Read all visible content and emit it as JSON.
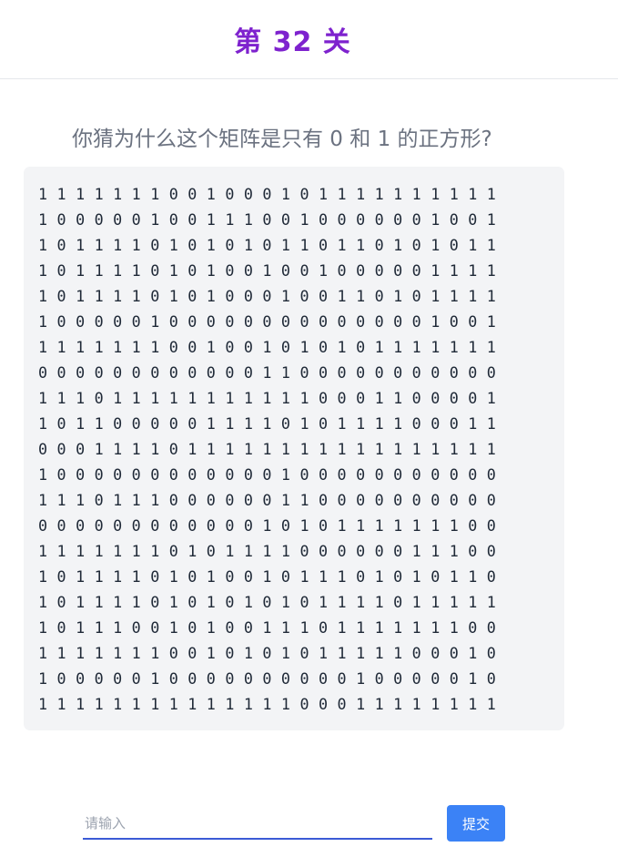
{
  "header": {
    "title": "第 32 关"
  },
  "question": {
    "text": "你猜为什么这个矩阵是只有 0 和 1 的正方形?"
  },
  "matrix": {
    "rows": [
      "1 1 1 1 1 1 1 0 0 1 0 0 0 1 0 1 1 1 1 1 1 1 1 1 1",
      "1 0 0 0 0 0 1 0 0 1 1 1 0 0 1 0 0 0 0 0 0 1 0 0 1",
      "1 0 1 1 1 1 0 1 0 1 0 1 0 1 1 0 1 1 0 1 0 1 0 1 1",
      "1 0 1 1 1 1 0 1 0 1 0 0 1 0 0 1 0 0 0 0 0 1 1 1 1",
      "1 0 1 1 1 1 0 1 0 1 0 0 0 1 0 0 1 1 0 1 0 1 1 1 1",
      "1 0 0 0 0 0 1 0 0 0 0 0 0 0 0 0 0 0 0 0 0 1 0 0 1",
      "1 1 1 1 1 1 1 0 0 1 0 0 1 0 1 0 1 0 1 1 1 1 1 1 1",
      "0 0 0 0 0 0 0 0 0 0 0 0 1 1 0 0 0 0 0 0 0 0 0 0 0",
      "1 1 1 0 1 1 1 1 1 1 1 1 1 1 1 0 0 0 1 1 0 0 0 0 1",
      "1 0 1 1 0 0 0 0 0 1 1 1 1 0 1 0 1 1 1 1 0 0 0 1 1",
      "0 0 0 1 1 1 1 0 1 1 1 1 1 1 1 1 1 1 1 1 1 1 1 1 1",
      "1 0 0 0 0 0 0 0 0 0 0 0 0 1 0 0 0 0 0 0 0 0 0 0 0",
      "1 1 1 0 1 1 1 0 0 0 0 0 0 1 1 0 0 0 0 0 0 0 0 0 0",
      "0 0 0 0 0 0 0 0 0 0 0 0 1 0 1 0 1 1 1 1 1 1 1 0 0",
      "1 1 1 1 1 1 1 0 1 0 1 1 1 1 0 0 0 0 0 0 1 1 1 0 0",
      "1 0 1 1 1 1 0 1 0 1 0 0 1 0 1 1 1 0 1 0 1 0 1 1 0",
      "1 0 1 1 1 1 0 1 0 1 0 1 0 1 0 1 1 1 1 0 1 1 1 1 1",
      "1 0 1 1 1 0 0 1 0 1 0 0 1 1 1 0 1 1 1 1 1 1 1 0 0",
      "1 1 1 1 1 1 1 0 0 1 0 1 0 1 0 1 1 1 1 1 0 0 0 1 0",
      "1 0 0 0 0 0 1 0 0 0 0 0 0 0 0 0 0 1 0 0 0 0 0 1 0",
      "1 1 1 1 1 1 1 1 1 1 1 1 1 1 0 0 0 1 1 1 1 1 1 1 1"
    ]
  },
  "answer": {
    "placeholder": "请输入",
    "value": ""
  },
  "submit": {
    "label": "提交"
  }
}
